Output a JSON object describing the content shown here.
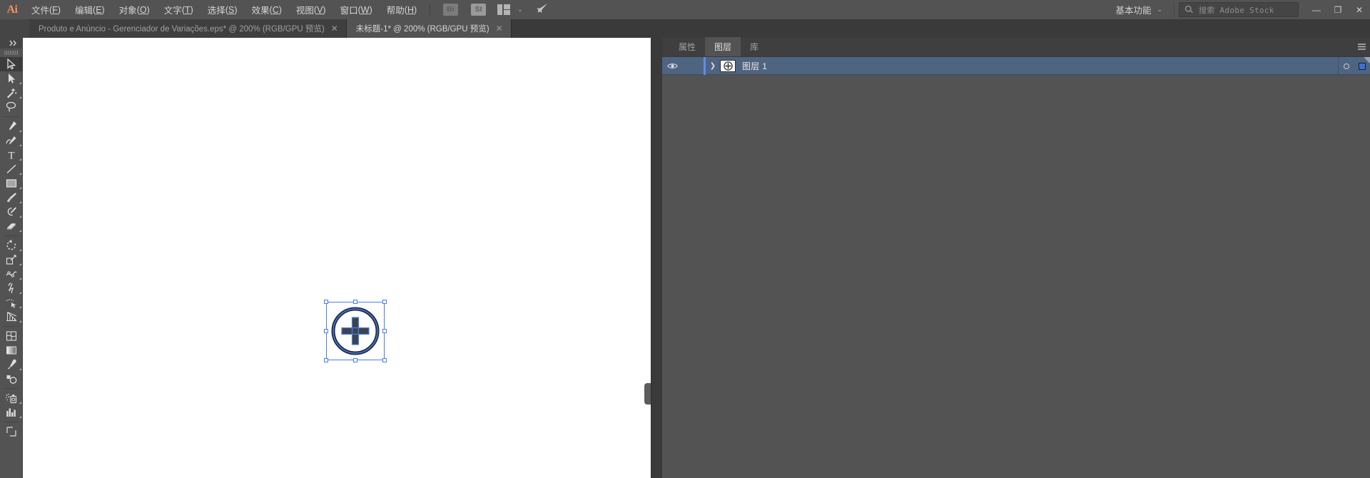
{
  "app": {
    "logo_text": "Ai",
    "accent_color": "#f0905c",
    "selection_color": "#4a7fe0",
    "panel_row_color": "#4f6480"
  },
  "menubar": {
    "items": [
      {
        "label": "文件",
        "accel": "F"
      },
      {
        "label": "编辑",
        "accel": "E"
      },
      {
        "label": "对象",
        "accel": "O"
      },
      {
        "label": "文字",
        "accel": "T"
      },
      {
        "label": "选择",
        "accel": "S"
      },
      {
        "label": "效果",
        "accel": "C"
      },
      {
        "label": "视图",
        "accel": "V"
      },
      {
        "label": "窗口",
        "accel": "W"
      },
      {
        "label": "帮助",
        "accel": "H"
      }
    ],
    "quick_icons": [
      {
        "name": "bridge-icon",
        "label": "Br"
      },
      {
        "name": "stock-icon",
        "label": "St"
      },
      {
        "name": "arrange-documents-icon",
        "label": ""
      },
      {
        "name": "chevron-down-icon",
        "label": "⌄"
      },
      {
        "name": "rocket-icon",
        "label": ""
      }
    ],
    "workspace": {
      "label": "基本功能",
      "chevron": "⌄"
    },
    "search": {
      "placeholder": "搜索 Adobe Stock",
      "icon": "search-icon"
    },
    "window_controls": {
      "minimize": "—",
      "restore": "❐",
      "close": "✕"
    }
  },
  "tabs": [
    {
      "title": "Produto e Anúncio - Gerenciador de Variações.eps* @ 200% (RGB/GPU 预览)",
      "close": "✕",
      "active": false
    },
    {
      "title": "未标题-1* @ 200% (RGB/GPU 预览)",
      "close": "✕",
      "active": true
    }
  ],
  "toolbar": {
    "expand_icon": "double-chevron-right-icon",
    "tools": [
      {
        "name": "selection-tool",
        "active": true,
        "has_flyout": false
      },
      {
        "name": "direct-selection-tool",
        "active": false,
        "has_flyout": true
      },
      {
        "name": "magic-wand-tool",
        "active": false,
        "has_flyout": true
      },
      {
        "name": "lasso-tool",
        "active": false,
        "has_flyout": false
      },
      {
        "divider": true
      },
      {
        "name": "pen-tool",
        "active": false,
        "has_flyout": true
      },
      {
        "name": "curvature-tool",
        "active": false,
        "has_flyout": true
      },
      {
        "name": "type-tool",
        "active": false,
        "has_flyout": true
      },
      {
        "name": "line-segment-tool",
        "active": false,
        "has_flyout": true
      },
      {
        "name": "rectangle-tool",
        "active": false,
        "has_flyout": true
      },
      {
        "name": "paintbrush-tool",
        "active": false,
        "has_flyout": true
      },
      {
        "name": "shaper-pencil-tool",
        "active": false,
        "has_flyout": true
      },
      {
        "name": "eraser-tool",
        "active": false,
        "has_flyout": true
      },
      {
        "divider": true
      },
      {
        "name": "rotate-tool",
        "active": false,
        "has_flyout": true
      },
      {
        "name": "scale-tool",
        "active": false,
        "has_flyout": true
      },
      {
        "name": "width-warp-tool",
        "active": false,
        "has_flyout": true
      },
      {
        "name": "free-transform-tool",
        "active": false,
        "has_flyout": true
      },
      {
        "name": "shape-builder-tool",
        "active": false,
        "has_flyout": true
      },
      {
        "name": "perspective-grid-tool",
        "active": false,
        "has_flyout": true
      },
      {
        "divider": true
      },
      {
        "name": "mesh-tool",
        "active": false,
        "has_flyout": false
      },
      {
        "name": "gradient-tool",
        "active": false,
        "has_flyout": false
      },
      {
        "name": "eyedropper-tool",
        "active": false,
        "has_flyout": true
      },
      {
        "name": "blend-tool",
        "active": false,
        "has_flyout": false
      },
      {
        "divider": true
      },
      {
        "name": "symbol-sprayer-tool",
        "active": false,
        "has_flyout": true
      },
      {
        "name": "column-graph-tool",
        "active": false,
        "has_flyout": true
      },
      {
        "divider": true
      },
      {
        "name": "artboard-tool",
        "active": false,
        "has_flyout": false
      }
    ]
  },
  "canvas": {
    "zoom": "200%",
    "object_name": "circle-plus-artwork",
    "selected": true,
    "collapse_handle": "canvas-collapse-handle"
  },
  "right_panel": {
    "tabs": [
      {
        "label": "属性",
        "name": "tab-properties",
        "active": false
      },
      {
        "label": "图层",
        "name": "tab-layers",
        "active": true
      },
      {
        "label": "库",
        "name": "tab-libraries",
        "active": false
      }
    ],
    "panel_menu_icon": "panel-menu-icon",
    "collapse_icon": "double-chevron-right-icon",
    "layers": [
      {
        "name": "图层 1",
        "visible": true,
        "locked": false,
        "expand_chevron": "❯",
        "selected": true,
        "targeted": false,
        "thumbnail": "circle-plus-thumbnail"
      }
    ]
  }
}
